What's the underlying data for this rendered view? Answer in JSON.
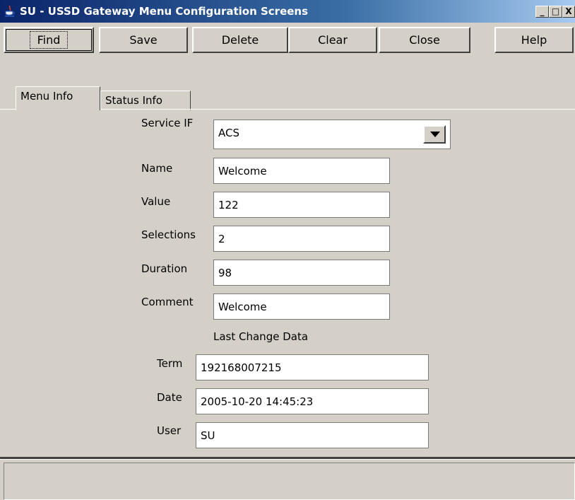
{
  "window": {
    "title": "SU - USSD Gateway Menu Configuration Screens",
    "min_glyph": "_",
    "max_glyph": "□",
    "close_glyph": "X"
  },
  "toolbar": {
    "find": "Find",
    "save": "Save",
    "delete": "Delete",
    "clear": "Clear",
    "close": "Close",
    "help": "Help"
  },
  "tabs": {
    "menu_info": "Menu Info",
    "status_info": "Status Info"
  },
  "form": {
    "service_if": {
      "label": "Service IF",
      "value": "ACS"
    },
    "name": {
      "label": "Name",
      "value": "Welcome"
    },
    "value": {
      "label": "Value",
      "value": "122"
    },
    "selections": {
      "label": "Selections",
      "value": "2"
    },
    "duration": {
      "label": "Duration",
      "value": "98"
    },
    "comment": {
      "label": "Comment",
      "value": "Welcome"
    }
  },
  "last_change": {
    "heading": "Last Change Data",
    "term": {
      "label": "Term",
      "value": "192168007215"
    },
    "date": {
      "label": "Date",
      "value": "2005-10-20 14:45:23"
    },
    "user": {
      "label": "User",
      "value": "SU"
    }
  },
  "status_bar": {
    "text": ""
  },
  "icons": {
    "app": "java-cup-icon",
    "dropdown": "chevron-down-icon"
  },
  "colors": {
    "titlebar_start": "#0a246a",
    "titlebar_end": "#a6caf0",
    "face": "#d4d0c8"
  }
}
